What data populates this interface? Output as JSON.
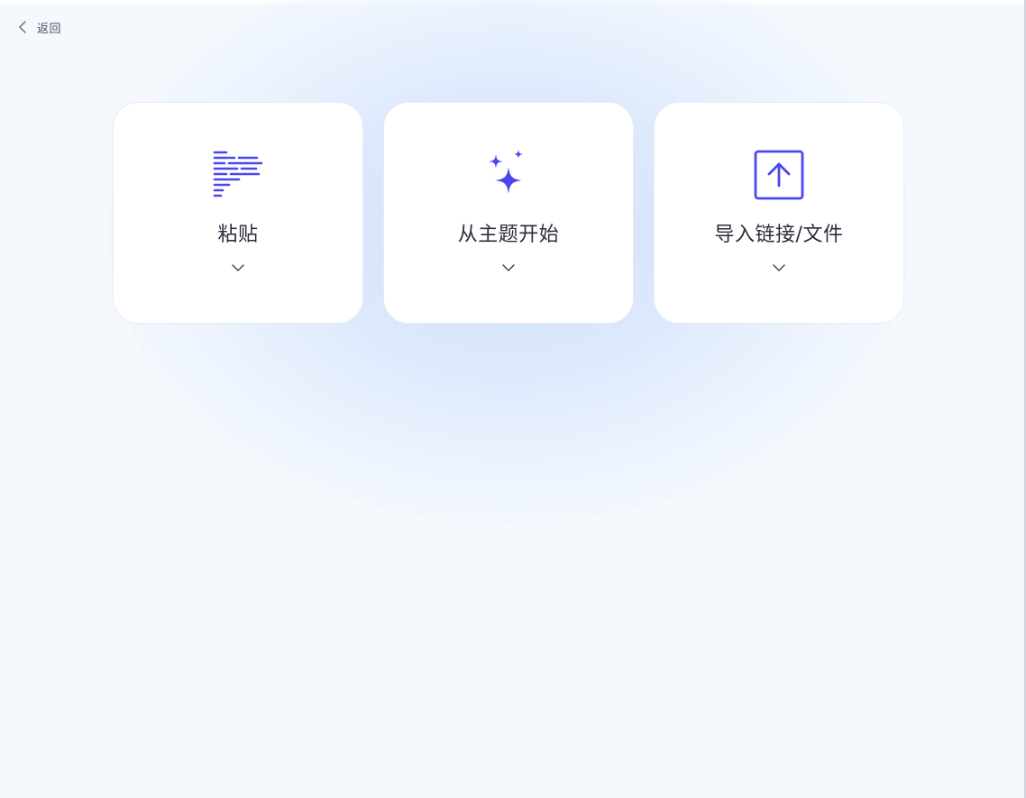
{
  "nav": {
    "back_label": "返回"
  },
  "cards": [
    {
      "title": "粘贴",
      "icon": "paste-text-lines-icon"
    },
    {
      "title": "从主题开始",
      "icon": "sparkles-icon"
    },
    {
      "title": "导入链接/文件",
      "icon": "upload-square-icon"
    }
  ],
  "colors": {
    "accent": "#4b47f0",
    "background": "#f5f9fe",
    "card": "#ffffff",
    "text": "#2b2f3a"
  }
}
